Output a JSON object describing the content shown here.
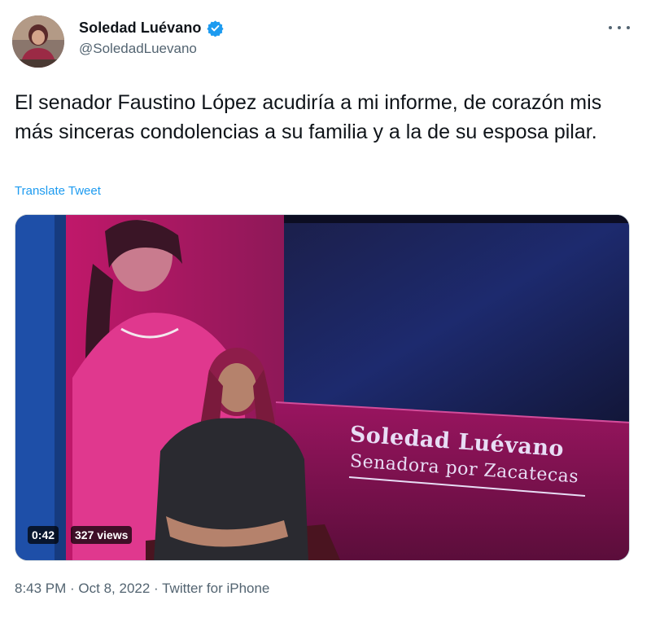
{
  "author": {
    "name": "Soledad Luévano",
    "handle": "@SoledadLuevano",
    "verified": true,
    "verified_color": "#1d9bf0"
  },
  "tweet": {
    "text": "El senador Faustino López acudiría a mi informe, de corazón mis más sinceras condolencias a su familia y a la de su esposa pilar.",
    "translate_label": "Translate Tweet"
  },
  "media": {
    "duration": "0:42",
    "views": "327 views",
    "banner_name": "Soledad Luévano",
    "banner_subtitle": "Senadora por Zacatecas"
  },
  "meta": {
    "timestamp": "8:43 PM · Oct 8, 2022 · Twitter for iPhone"
  },
  "icons": {
    "more": "more-options-icon",
    "verified": "verified-badge-icon"
  },
  "colors": {
    "accent": "#1d9bf0",
    "text": "#0f1419",
    "secondary": "#536471"
  }
}
